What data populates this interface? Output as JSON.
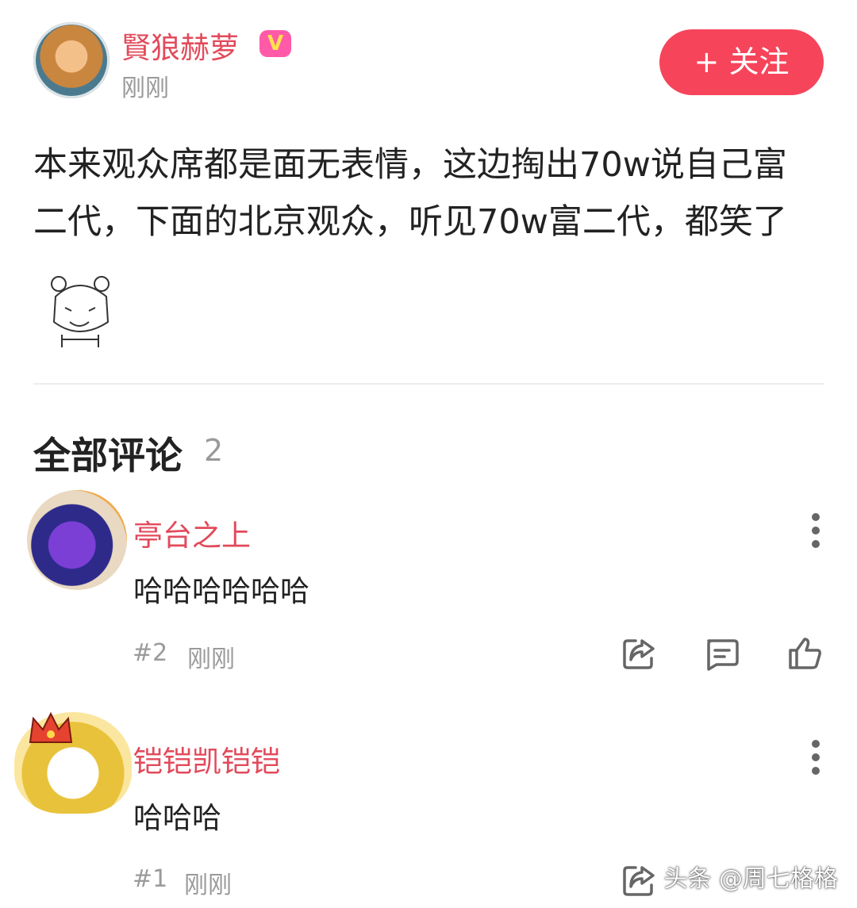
{
  "post": {
    "author": "賢狼赫萝",
    "time": "刚刚",
    "follow_label": "+ 关注",
    "text": "本来观众席都是面无表情，这边掏出70w说自己富二代，下面的北京观众，听见70w富二代，都笑了"
  },
  "comments_section": {
    "title": "全部评论",
    "count": "2"
  },
  "comments": [
    {
      "username": "亭台之上",
      "text": "哈哈哈哈哈哈",
      "floor": "#2",
      "time": "刚刚"
    },
    {
      "username": "铠铠凯铠铠",
      "text": "哈哈哈",
      "floor": "#1",
      "time": "刚刚"
    }
  ],
  "watermark": "头条 @周七格格",
  "colors": {
    "accent": "#f6445a",
    "username": "#e24a5b",
    "muted": "#999999"
  },
  "icons": [
    "more-vertical-icon",
    "share-icon",
    "comment-icon",
    "like-icon"
  ]
}
